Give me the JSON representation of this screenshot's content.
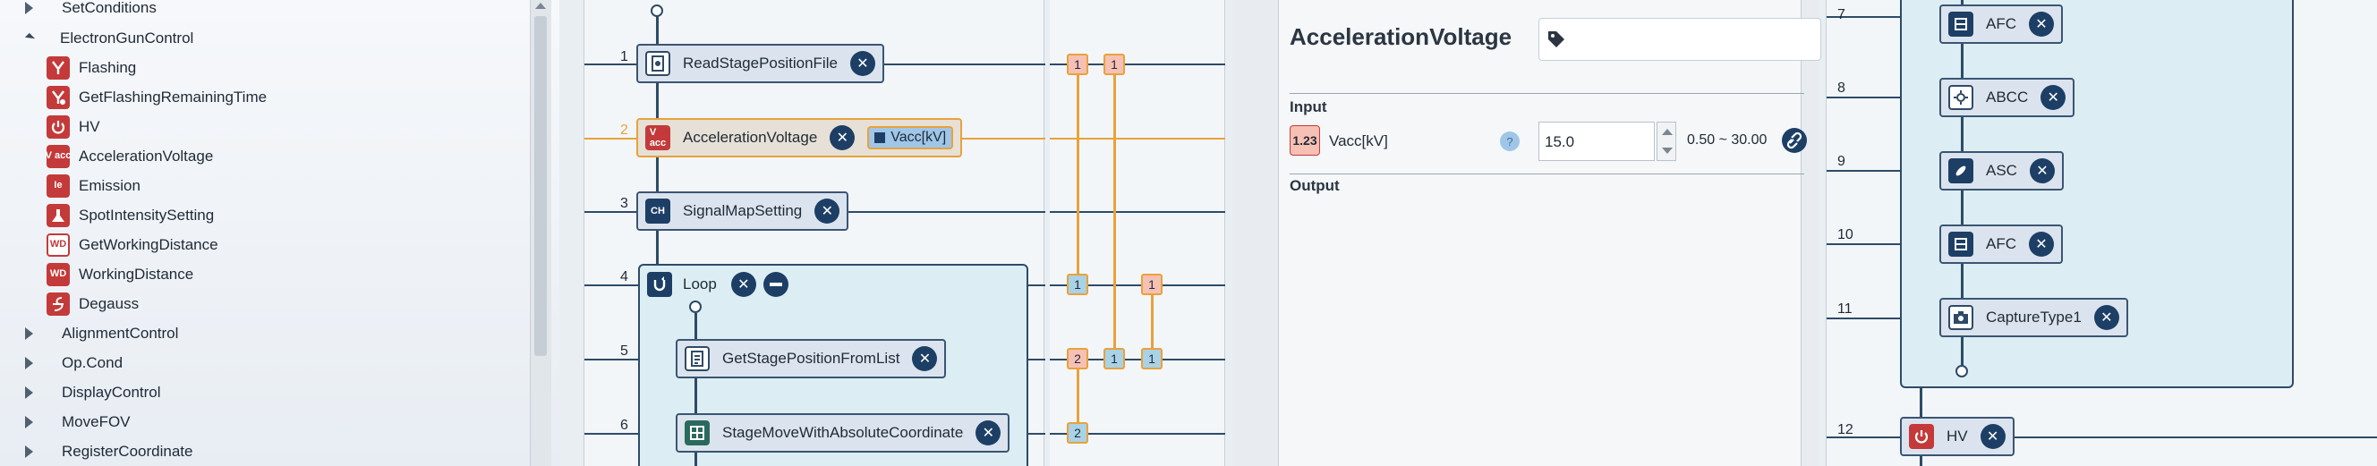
{
  "tree": {
    "items": [
      {
        "label": "SetConditions",
        "kind": "collapsed"
      },
      {
        "label": "ElectronGunControl",
        "kind": "expanded"
      },
      {
        "label": "Flashing",
        "icon": "flashing-icon"
      },
      {
        "label": "GetFlashingRemainingTime",
        "icon": "flashing-timer-icon"
      },
      {
        "label": "HV",
        "icon": "power-icon"
      },
      {
        "label": "AccelerationVoltage",
        "icon": "acceleration-voltage-icon",
        "icon_text": "V acc"
      },
      {
        "label": "Emission",
        "icon": "emission-icon",
        "icon_text": "Ie"
      },
      {
        "label": "SpotIntensitySetting",
        "icon": "spot-intensity-icon"
      },
      {
        "label": "GetWorkingDistance",
        "icon": "working-distance-icon",
        "icon_text": "WD"
      },
      {
        "label": "WorkingDistance",
        "icon": "working-distance-icon",
        "icon_text": "WD"
      },
      {
        "label": "Degauss",
        "icon": "degauss-icon"
      },
      {
        "label": "AlignmentControl",
        "kind": "collapsed"
      },
      {
        "label": "Op.Cond",
        "kind": "collapsed"
      },
      {
        "label": "DisplayControl",
        "kind": "collapsed"
      },
      {
        "label": "MoveFOV",
        "kind": "collapsed"
      },
      {
        "label": "RegisterCoordinate",
        "kind": "collapsed"
      }
    ]
  },
  "flow": {
    "rows": [
      {
        "num": "1",
        "label": "ReadStagePositionFile"
      },
      {
        "num": "2",
        "label": "AccelerationVoltage",
        "chip": "Vacc[kV]"
      },
      {
        "num": "3",
        "label": "SignalMapSetting",
        "icon_text": "CH"
      },
      {
        "num": "4",
        "label": "Loop"
      },
      {
        "num": "5",
        "label": "GetStagePositionFromList"
      },
      {
        "num": "6",
        "label": "StageMoveWithAbsoluteCoordinate"
      }
    ]
  },
  "vars": {
    "badges": [
      "1",
      "1",
      "1",
      "1",
      "2",
      "1",
      "1",
      "2"
    ]
  },
  "props": {
    "title": "AccelerationVoltage",
    "input_header": "Input",
    "output_header": "Output",
    "param": {
      "type_badge": "1.23",
      "name": "Vacc[kV]",
      "value": "15.0",
      "range": "0.50 ~ 30.00"
    }
  },
  "flow2": {
    "rows": [
      {
        "num": "7",
        "label": "AFC"
      },
      {
        "num": "8",
        "label": "ABCC"
      },
      {
        "num": "9",
        "label": "ASC"
      },
      {
        "num": "10",
        "label": "AFC"
      },
      {
        "num": "11",
        "label": "CaptureType1"
      },
      {
        "num": "12",
        "label": "HV"
      }
    ]
  },
  "colors": {
    "accent_orange": "#e8a23a",
    "node_dark": "#1d3f66",
    "icon_red": "#c43a3a"
  }
}
